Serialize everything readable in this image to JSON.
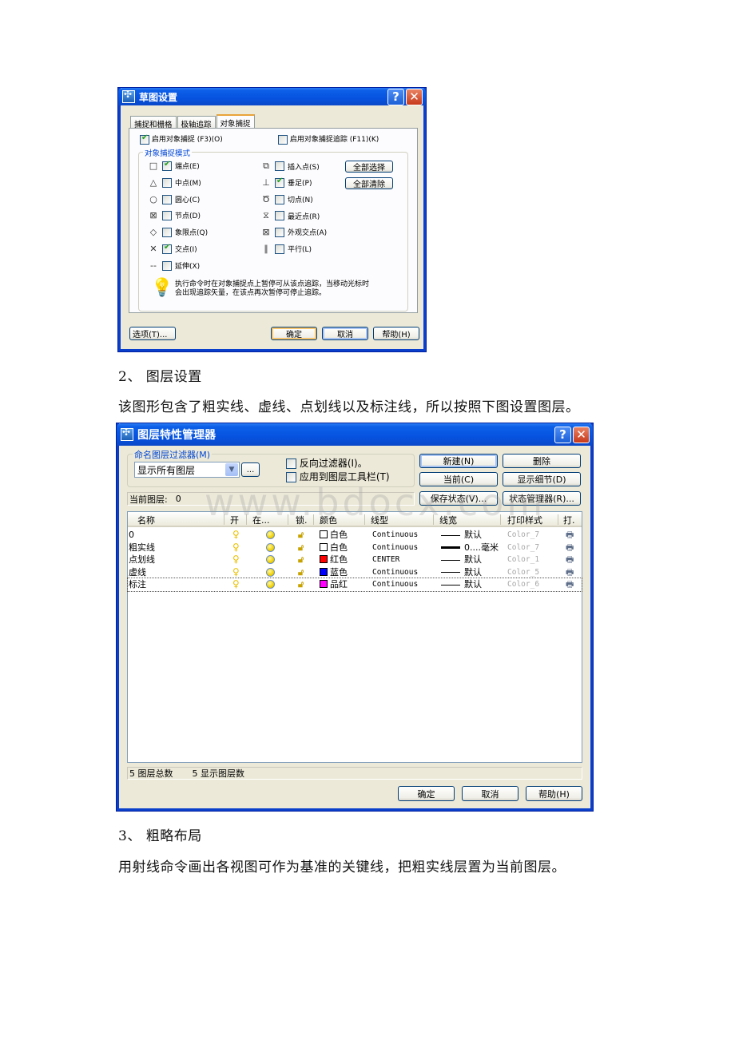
{
  "document": {
    "section2_heading": "2、 图层设置",
    "section2_body": "该图形包含了粗实线、虚线、点划线以及标注线，所以按照下图设置图层。",
    "section3_heading": "3、 粗略布局",
    "section3_body": "用射线命令画出各视图可作为基准的关键线，把粗实线层置为当前图层。",
    "watermark": "www.bdocx.com"
  },
  "drafting_dialog": {
    "title": "草图设置",
    "help_glyph": "?",
    "close_glyph": "✕",
    "tabs": [
      {
        "label": "捕捉和栅格",
        "active": false
      },
      {
        "label": "极轴追踪",
        "active": false
      },
      {
        "label": "对象捕捉",
        "active": true
      }
    ],
    "enable_osnap": {
      "label": "启用对象捕捉 (F3)(O)",
      "checked": true
    },
    "enable_osnap_tracking": {
      "label": "启用对象捕捉追踪 (F11)(K)",
      "checked": false
    },
    "group_label": "对象捕捉模式",
    "snap_modes_left": [
      {
        "glyph": "□",
        "label": "端点(E)",
        "checked": true
      },
      {
        "glyph": "△",
        "label": "中点(M)",
        "checked": false
      },
      {
        "glyph": "○",
        "label": "圆心(C)",
        "checked": false
      },
      {
        "glyph": "⊠",
        "label": "节点(D)",
        "checked": false
      },
      {
        "glyph": "◇",
        "label": "象限点(Q)",
        "checked": false
      },
      {
        "glyph": "✕",
        "label": "交点(I)",
        "checked": true
      },
      {
        "glyph": "--",
        "label": "延伸(X)",
        "checked": false
      }
    ],
    "snap_modes_right": [
      {
        "glyph": "⧉",
        "label": "插入点(S)",
        "checked": false
      },
      {
        "glyph": "⊥",
        "label": "垂足(P)",
        "checked": true
      },
      {
        "glyph": "Ծ",
        "label": "切点(N)",
        "checked": false
      },
      {
        "glyph": "⧖",
        "label": "最近点(R)",
        "checked": false
      },
      {
        "glyph": "⊠",
        "label": "外观交点(A)",
        "checked": false
      },
      {
        "glyph": "∥",
        "label": "平行(L)",
        "checked": false
      }
    ],
    "select_all_label": "全部选择",
    "clear_all_label": "全部清除",
    "tip_line1": "执行命令时在对象捕捉点上暂停可从该点追踪，当移动光标时",
    "tip_line2": "会出现追踪矢量，在该点再次暂停可停止追踪。",
    "options_label": "选项(T)...",
    "ok_label": "确定",
    "cancel_label": "取消",
    "help_label": "帮助(H)"
  },
  "layer_dialog": {
    "title": "图层特性管理器",
    "help_glyph": "?",
    "close_glyph": "✕",
    "filter_group_label": "命名图层过滤器(M)",
    "filter_value": "显示所有图层",
    "browse_label": "...",
    "invert_filter": {
      "label": "反向过滤器(I)。",
      "checked": false
    },
    "apply_toolbar": {
      "label": "应用到图层工具栏(T)",
      "checked": false
    },
    "buttons": {
      "new": "新建(N)",
      "delete": "删除",
      "current": "当前(C)",
      "show_details": "显示细节(D)",
      "save_state": "保存状态(V)...",
      "state_manager": "状态管理器(R)..."
    },
    "current_layer_label": "当前图层:",
    "current_layer_value": "0",
    "columns": [
      "名称",
      "开",
      "在...",
      "锁.",
      "颜色",
      "线型",
      "线宽",
      "打印样式",
      "打."
    ],
    "layers": [
      {
        "name": "0",
        "color_name": "白色",
        "color_hex": "#ffffff",
        "linetype": "Continuous",
        "lineweight": "默认",
        "lw_thick": false,
        "plot_style": "Color_7"
      },
      {
        "name": "粗实线",
        "color_name": "白色",
        "color_hex": "#ffffff",
        "linetype": "Continuous",
        "lineweight": "0....毫米",
        "lw_thick": true,
        "plot_style": "Color_7"
      },
      {
        "name": "点划线",
        "color_name": "红色",
        "color_hex": "#ff0000",
        "linetype": "CENTER",
        "lineweight": "默认",
        "lw_thick": false,
        "plot_style": "Color_1"
      },
      {
        "name": "虚线",
        "color_name": "蓝色",
        "color_hex": "#0000ff",
        "linetype": "Continuous",
        "lineweight": "默认",
        "lw_thick": false,
        "plot_style": "Color_5"
      },
      {
        "name": "标注",
        "color_name": "品红",
        "color_hex": "#ff00ff",
        "linetype": "Continuous",
        "lineweight": "默认",
        "lw_thick": false,
        "plot_style": "Color_6",
        "selected": true
      }
    ],
    "total_layers": "5 图层总数",
    "displayed_layers": "5 显示图层数",
    "ok_label": "确定",
    "cancel_label": "取消",
    "help_label": "帮助(H)"
  }
}
